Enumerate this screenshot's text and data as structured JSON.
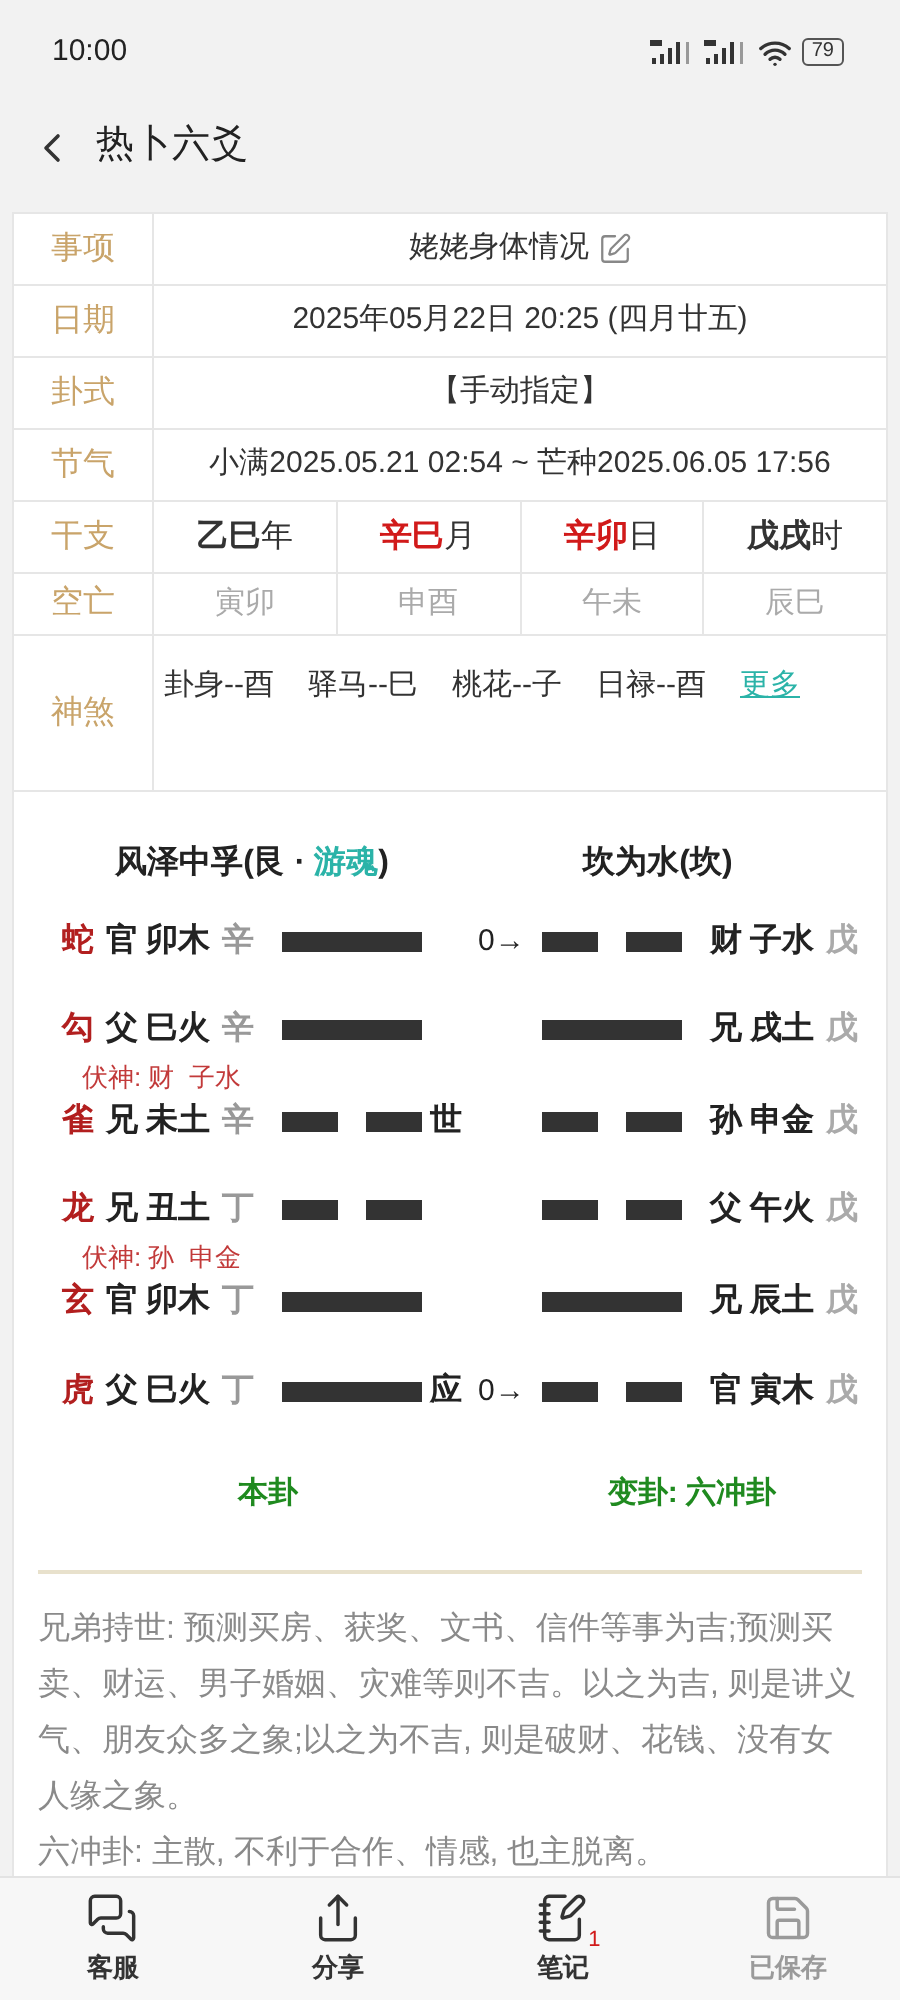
{
  "status_bar": {
    "time": "10:00",
    "battery": "79"
  },
  "header": {
    "title": "热卜六爻"
  },
  "info_table": {
    "rows": [
      {
        "kind": "text",
        "label": "事项",
        "value": "姥姥身体情况",
        "editable": true
      },
      {
        "kind": "text",
        "label": "日期",
        "value": "2025年05月22日 20:25 (四月廿五)",
        "editable": false
      },
      {
        "kind": "text",
        "label": "卦式",
        "value": "【手动指定】",
        "editable": false
      },
      {
        "kind": "text",
        "label": "节气",
        "value": "小满2025.05.21 02:54 ~ 芒种2025.06.05 17:56",
        "editable": false
      },
      {
        "kind": "ganzhi",
        "label": "干支",
        "cells": [
          {
            "pillar": "乙巳",
            "unit": "年",
            "highlight": false
          },
          {
            "pillar": "辛巳",
            "unit": "月",
            "highlight": true
          },
          {
            "pillar": "辛卯",
            "unit": "日",
            "highlight": true
          },
          {
            "pillar": "戊戌",
            "unit": "时",
            "highlight": false
          }
        ]
      },
      {
        "kind": "kongwang",
        "label": "空亡",
        "cells": [
          "寅卯",
          "申酉",
          "午未",
          "辰巳"
        ]
      },
      {
        "kind": "shensha",
        "label": "神煞",
        "items": [
          "卦身--酉",
          "驿马--巳",
          "桃花--子",
          "日禄--酉"
        ],
        "more": "更多"
      }
    ]
  },
  "hexagram": {
    "original_title": {
      "name": "风泽中孚(艮 · ",
      "palace_type": "游魂",
      "close": ")"
    },
    "changed_title": "坎为水(坎)",
    "lines": [
      {
        "beast": "蛇",
        "relation": "官",
        "branch": "卯木",
        "stem": "辛",
        "kind": "yang",
        "moving": "0→",
        "changed": {
          "kind": "yin",
          "relation": "财",
          "branch": "子水",
          "stem": "戊"
        }
      },
      {
        "beast": "勾",
        "relation": "父",
        "branch": "巳火",
        "stem": "辛",
        "kind": "yang",
        "fushen": "伏神: 财  子水",
        "changed": {
          "kind": "yang",
          "relation": "兄",
          "branch": "戌土",
          "stem": "戊"
        }
      },
      {
        "beast": "雀",
        "relation": "兄",
        "branch": "未土",
        "stem": "辛",
        "kind": "yin",
        "marker": "世",
        "changed": {
          "kind": "yin",
          "relation": "孙",
          "branch": "申金",
          "stem": "戊"
        }
      },
      {
        "beast": "龙",
        "relation": "兄",
        "branch": "丑土",
        "stem": "丁",
        "kind": "yin",
        "fushen": "伏神: 孙  申金",
        "changed": {
          "kind": "yin",
          "relation": "父",
          "branch": "午火",
          "stem": "戊"
        }
      },
      {
        "beast": "玄",
        "relation": "官",
        "branch": "卯木",
        "stem": "丁",
        "kind": "yang",
        "changed": {
          "kind": "yang",
          "relation": "兄",
          "branch": "辰土",
          "stem": "戊"
        }
      },
      {
        "beast": "虎",
        "relation": "父",
        "branch": "巳火",
        "stem": "丁",
        "kind": "yang",
        "marker": "应",
        "moving": "0→",
        "changed": {
          "kind": "yin",
          "relation": "官",
          "branch": "寅木",
          "stem": "戊"
        }
      }
    ],
    "original_label": "本卦",
    "changed_label": "变卦: 六冲卦"
  },
  "interpretation": [
    "兄弟持世: 预测买房、获奖、文书、信件等事为吉;预测买卖、财运、男子婚姻、灾难等则不吉。以之为吉, 则是讲义气、朋友众多之象;以之为不吉, 则是破财、花钱、没有女人缘之象。",
    "六冲卦: 主散, 不利于合作、情感, 也主脱离。"
  ],
  "bottom_nav": [
    {
      "kind": "service",
      "label": "客服",
      "disabled": false
    },
    {
      "kind": "share",
      "label": "分享",
      "disabled": false
    },
    {
      "kind": "notes",
      "label": "笔记",
      "badge": "1",
      "disabled": false
    },
    {
      "kind": "save",
      "label": "已保存",
      "disabled": true
    }
  ]
}
